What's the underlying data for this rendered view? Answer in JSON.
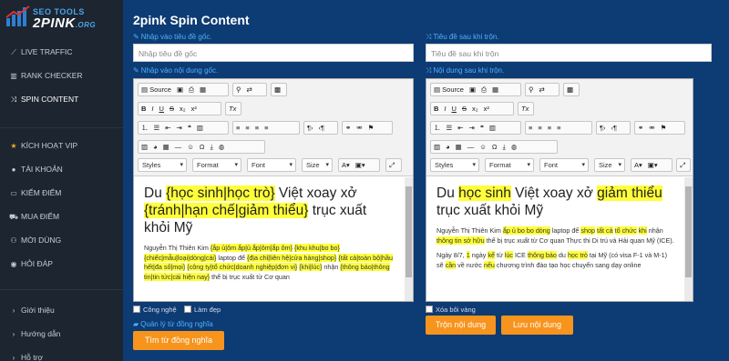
{
  "logo": {
    "line1": "SEO TOOLS",
    "line2": "2PINK",
    "suffix": ".ORG"
  },
  "sidebar": {
    "items": [
      {
        "label": "LIVE TRAFFIC",
        "icon": "chart-line-icon",
        "glyph": "⟋"
      },
      {
        "label": "RANK CHECKER",
        "icon": "chart-bar-icon",
        "glyph": "▥"
      },
      {
        "label": "SPIN CONTENT",
        "icon": "shuffle-icon",
        "glyph": "⤨"
      },
      {
        "label": "KÍCH HOẠT VIP",
        "icon": "star-icon",
        "glyph": "★"
      },
      {
        "label": "TÀI KHOẢN",
        "icon": "user-icon",
        "glyph": "👤"
      },
      {
        "label": "KIẾM ĐIỂM",
        "icon": "laptop-icon",
        "glyph": "💻"
      },
      {
        "label": "MUA ĐIỂM",
        "icon": "cart-icon",
        "glyph": "🛒"
      },
      {
        "label": "MỜI DÙNG",
        "icon": "users-icon",
        "glyph": "👥"
      },
      {
        "label": "HỎI ĐÁP",
        "icon": "chat-icon",
        "glyph": "💬"
      }
    ],
    "bottom": [
      {
        "label": "Giới thiệu"
      },
      {
        "label": "Hướng dẫn"
      },
      {
        "label": "Hỗ trợ"
      }
    ]
  },
  "main": {
    "title": "2pink Spin Content",
    "left": {
      "title_label": "Nhập vào tiêu đề gốc.",
      "title_placeholder": "Nhập tiêu đề gốc",
      "content_label": "Nhập vào nội dung gốc.",
      "heading_parts": [
        {
          "t": "Du ",
          "hl": false
        },
        {
          "t": "{học sinh|học trò}",
          "hl": true
        },
        {
          "t": " Việt xoay xở ",
          "hl": false
        },
        {
          "t": "{tránh|hạn chế|giảm thiểu}",
          "hl": true
        },
        {
          "t": " trục xuất khỏi Mỹ",
          "hl": false
        }
      ],
      "body_parts": [
        {
          "t": "Nguyễn Thị Thiên Kim ",
          "hl": false
        },
        {
          "t": "{ắp ủ|ôm ắp|ủ ắp|ôm|ắp ôm}",
          "hl": true
        },
        {
          "t": " ",
          "hl": false
        },
        {
          "t": "{khu khu|bo bo}",
          "hl": true
        },
        {
          "t": " ",
          "hl": false
        },
        {
          "t": "{chiếc|mẫu|loại|dòng|cái}",
          "hl": true
        },
        {
          "t": " laptop để ",
          "hl": false
        },
        {
          "t": "{địa chỉ|liên hệ|cửa hàng|shop}",
          "hl": true
        },
        {
          "t": " ",
          "hl": false
        },
        {
          "t": "{tất cả|toàn bộ|hầu hết|đa số|mọi}",
          "hl": true
        },
        {
          "t": " ",
          "hl": false
        },
        {
          "t": "{công ty|tổ chức|doanh nghiệp|đơn vị}",
          "hl": true
        },
        {
          "t": " ",
          "hl": false
        },
        {
          "t": "{khi|lúc}",
          "hl": true
        },
        {
          "t": " nhận ",
          "hl": false
        },
        {
          "t": "{thông báo|thông tin|tin tức|cái hiện nay}",
          "hl": true
        },
        {
          "t": " thể bị trục xuất từ Cơ quan",
          "hl": false
        }
      ],
      "cb1": "Công nghệ",
      "cb2": "Làm đẹp",
      "synonym_link": "Quản lý từ đồng nghĩa",
      "find_button": "Tìm từ đồng nghĩa"
    },
    "right": {
      "title_label": "Tiêu đề sau khi trộn.",
      "title_placeholder": "Tiêu đề sau khi trộn",
      "content_label": "Nội dung sau khi trộn.",
      "heading_parts": [
        {
          "t": "Du ",
          "hl": false
        },
        {
          "t": "học sinh",
          "hl": true
        },
        {
          "t": " Việt xoay xở ",
          "hl": false
        },
        {
          "t": "giảm thiểu",
          "hl": true
        },
        {
          "t": " trục xuất khỏi Mỹ",
          "hl": false
        }
      ],
      "body1_parts": [
        {
          "t": "Nguyễn Thị Thiên Kim ",
          "hl": false
        },
        {
          "t": "ắp ủ bo bo dòng",
          "hl": true
        },
        {
          "t": " laptop để ",
          "hl": false
        },
        {
          "t": "shop",
          "hl": true
        },
        {
          "t": " ",
          "hl": false
        },
        {
          "t": "tất cả",
          "hl": true
        },
        {
          "t": " ",
          "hl": false
        },
        {
          "t": "tổ chức",
          "hl": true
        },
        {
          "t": " ",
          "hl": false
        },
        {
          "t": "khi",
          "hl": true
        },
        {
          "t": " nhận ",
          "hl": false
        },
        {
          "t": "thông tin sở hữu",
          "hl": true
        },
        {
          "t": " thể bị trục xuất từ Cơ quan Thực thi Di trú và Hải quan Mỹ (ICE).",
          "hl": false
        }
      ],
      "body2_parts": [
        {
          "t": "Ngày 8/7, ",
          "hl": false
        },
        {
          "t": "1",
          "hl": true
        },
        {
          "t": " ngày ",
          "hl": false
        },
        {
          "t": "kể",
          "hl": true
        },
        {
          "t": " từ ",
          "hl": false
        },
        {
          "t": "lúc",
          "hl": true
        },
        {
          "t": " ICE ",
          "hl": false
        },
        {
          "t": "thông báo",
          "hl": true
        },
        {
          "t": " du ",
          "hl": false
        },
        {
          "t": "học trò",
          "hl": true
        },
        {
          "t": " tại Mỹ (có visa F-1 và M-1) sẽ ",
          "hl": false
        },
        {
          "t": "cần",
          "hl": true
        },
        {
          "t": " về nước ",
          "hl": false
        },
        {
          "t": "nếu",
          "hl": true
        },
        {
          "t": " chương trình đào tạo học chuyển sang dạy online",
          "hl": false
        }
      ],
      "cb": "Xóa bôi vàng",
      "mix_button": "Trộn nội dung",
      "save_button": "Lưu nội dung"
    },
    "toolbar": {
      "source": "Source",
      "styles": "Styles",
      "format": "Format",
      "font": "Font",
      "size": "Size"
    }
  },
  "colors": {
    "background": "#0d3b73",
    "sidebar": "#1c2530",
    "accent": "#f7941d",
    "link": "#4fb0ff",
    "highlight": "#ffff3a"
  }
}
